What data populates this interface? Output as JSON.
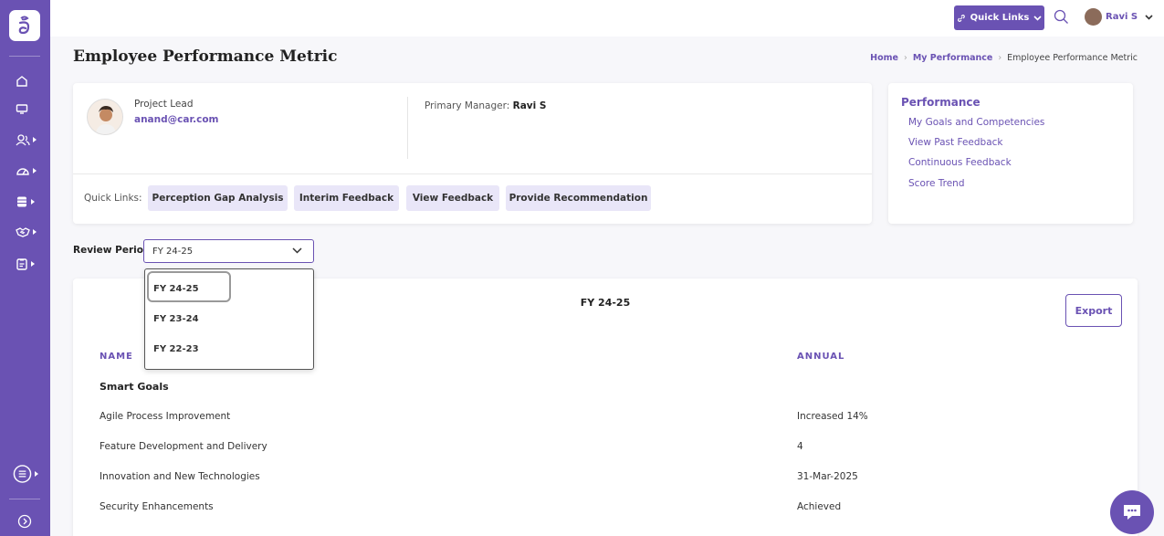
{
  "topbar": {
    "quick_links_label": "Quick Links",
    "user_name": "Ravi S"
  },
  "page": {
    "title": "Employee Performance Metric"
  },
  "breadcrumb": {
    "home": "Home",
    "my_performance": "My Performance",
    "current": "Employee Performance Metric"
  },
  "profile": {
    "role": "Project Lead",
    "email": "anand@car.com",
    "primary_manager_label": "Primary Manager:",
    "primary_manager_name": "Ravi S",
    "quick_links_label": "Quick Links:",
    "chips": [
      "Perception Gap Analysis",
      "Interim Feedback",
      "View Feedback",
      "Provide Recommendation"
    ]
  },
  "performance_menu": {
    "title": "Performance",
    "links": [
      "My Goals and Competencies",
      "View Past Feedback",
      "Continuous Feedback",
      "Score Trend"
    ]
  },
  "review_period": {
    "label": "Review Period:",
    "selected": "FY 24-25",
    "options": [
      "FY 24-25",
      "FY 23-24",
      "FY 22-23"
    ]
  },
  "metrics": {
    "title": "FY 24-25",
    "export_label": "Export",
    "col_name": "NAME",
    "col_annual": "ANNUAL",
    "group": "Smart Goals",
    "rows": [
      {
        "name": "Agile Process Improvement",
        "annual": "Increased 14%"
      },
      {
        "name": "Feature Development and Delivery",
        "annual": "4"
      },
      {
        "name": "Innovation and New Technologies",
        "annual": "31-Mar-2025"
      },
      {
        "name": "Security Enhancements",
        "annual": "Achieved"
      }
    ]
  },
  "colors": {
    "brand": "#6a52b3",
    "chip_bg": "#e9e6f8"
  }
}
